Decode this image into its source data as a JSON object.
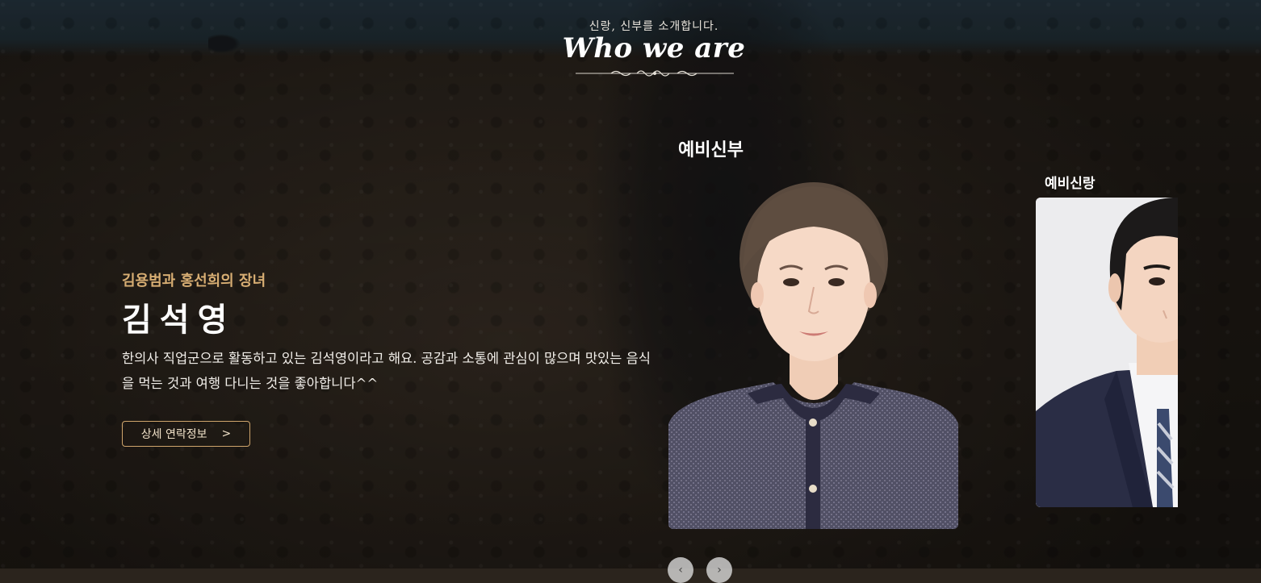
{
  "header": {
    "subtitle": "신랑, 신부를 소개합니다.",
    "title": "Who we are"
  },
  "labels": {
    "bride": "예비신부",
    "groom": "예비신랑"
  },
  "profile": {
    "parents": "김용범과 홍선희의 장녀",
    "name": "김석영",
    "description": "한의사 직업군으로 활동하고 있는 김석영이라고 해요. 공감과 소통에 관심이 많으며 맛있는 음식을 먹는 것과 여행 다니는 것을 좋아합니다^^",
    "button_label": "상세 연락정보",
    "button_icon": ">"
  },
  "carousel": {
    "prev_icon": "‹",
    "next_icon": "›"
  },
  "colors": {
    "accent": "#d8ae73",
    "button_border": "#cfa56c"
  }
}
